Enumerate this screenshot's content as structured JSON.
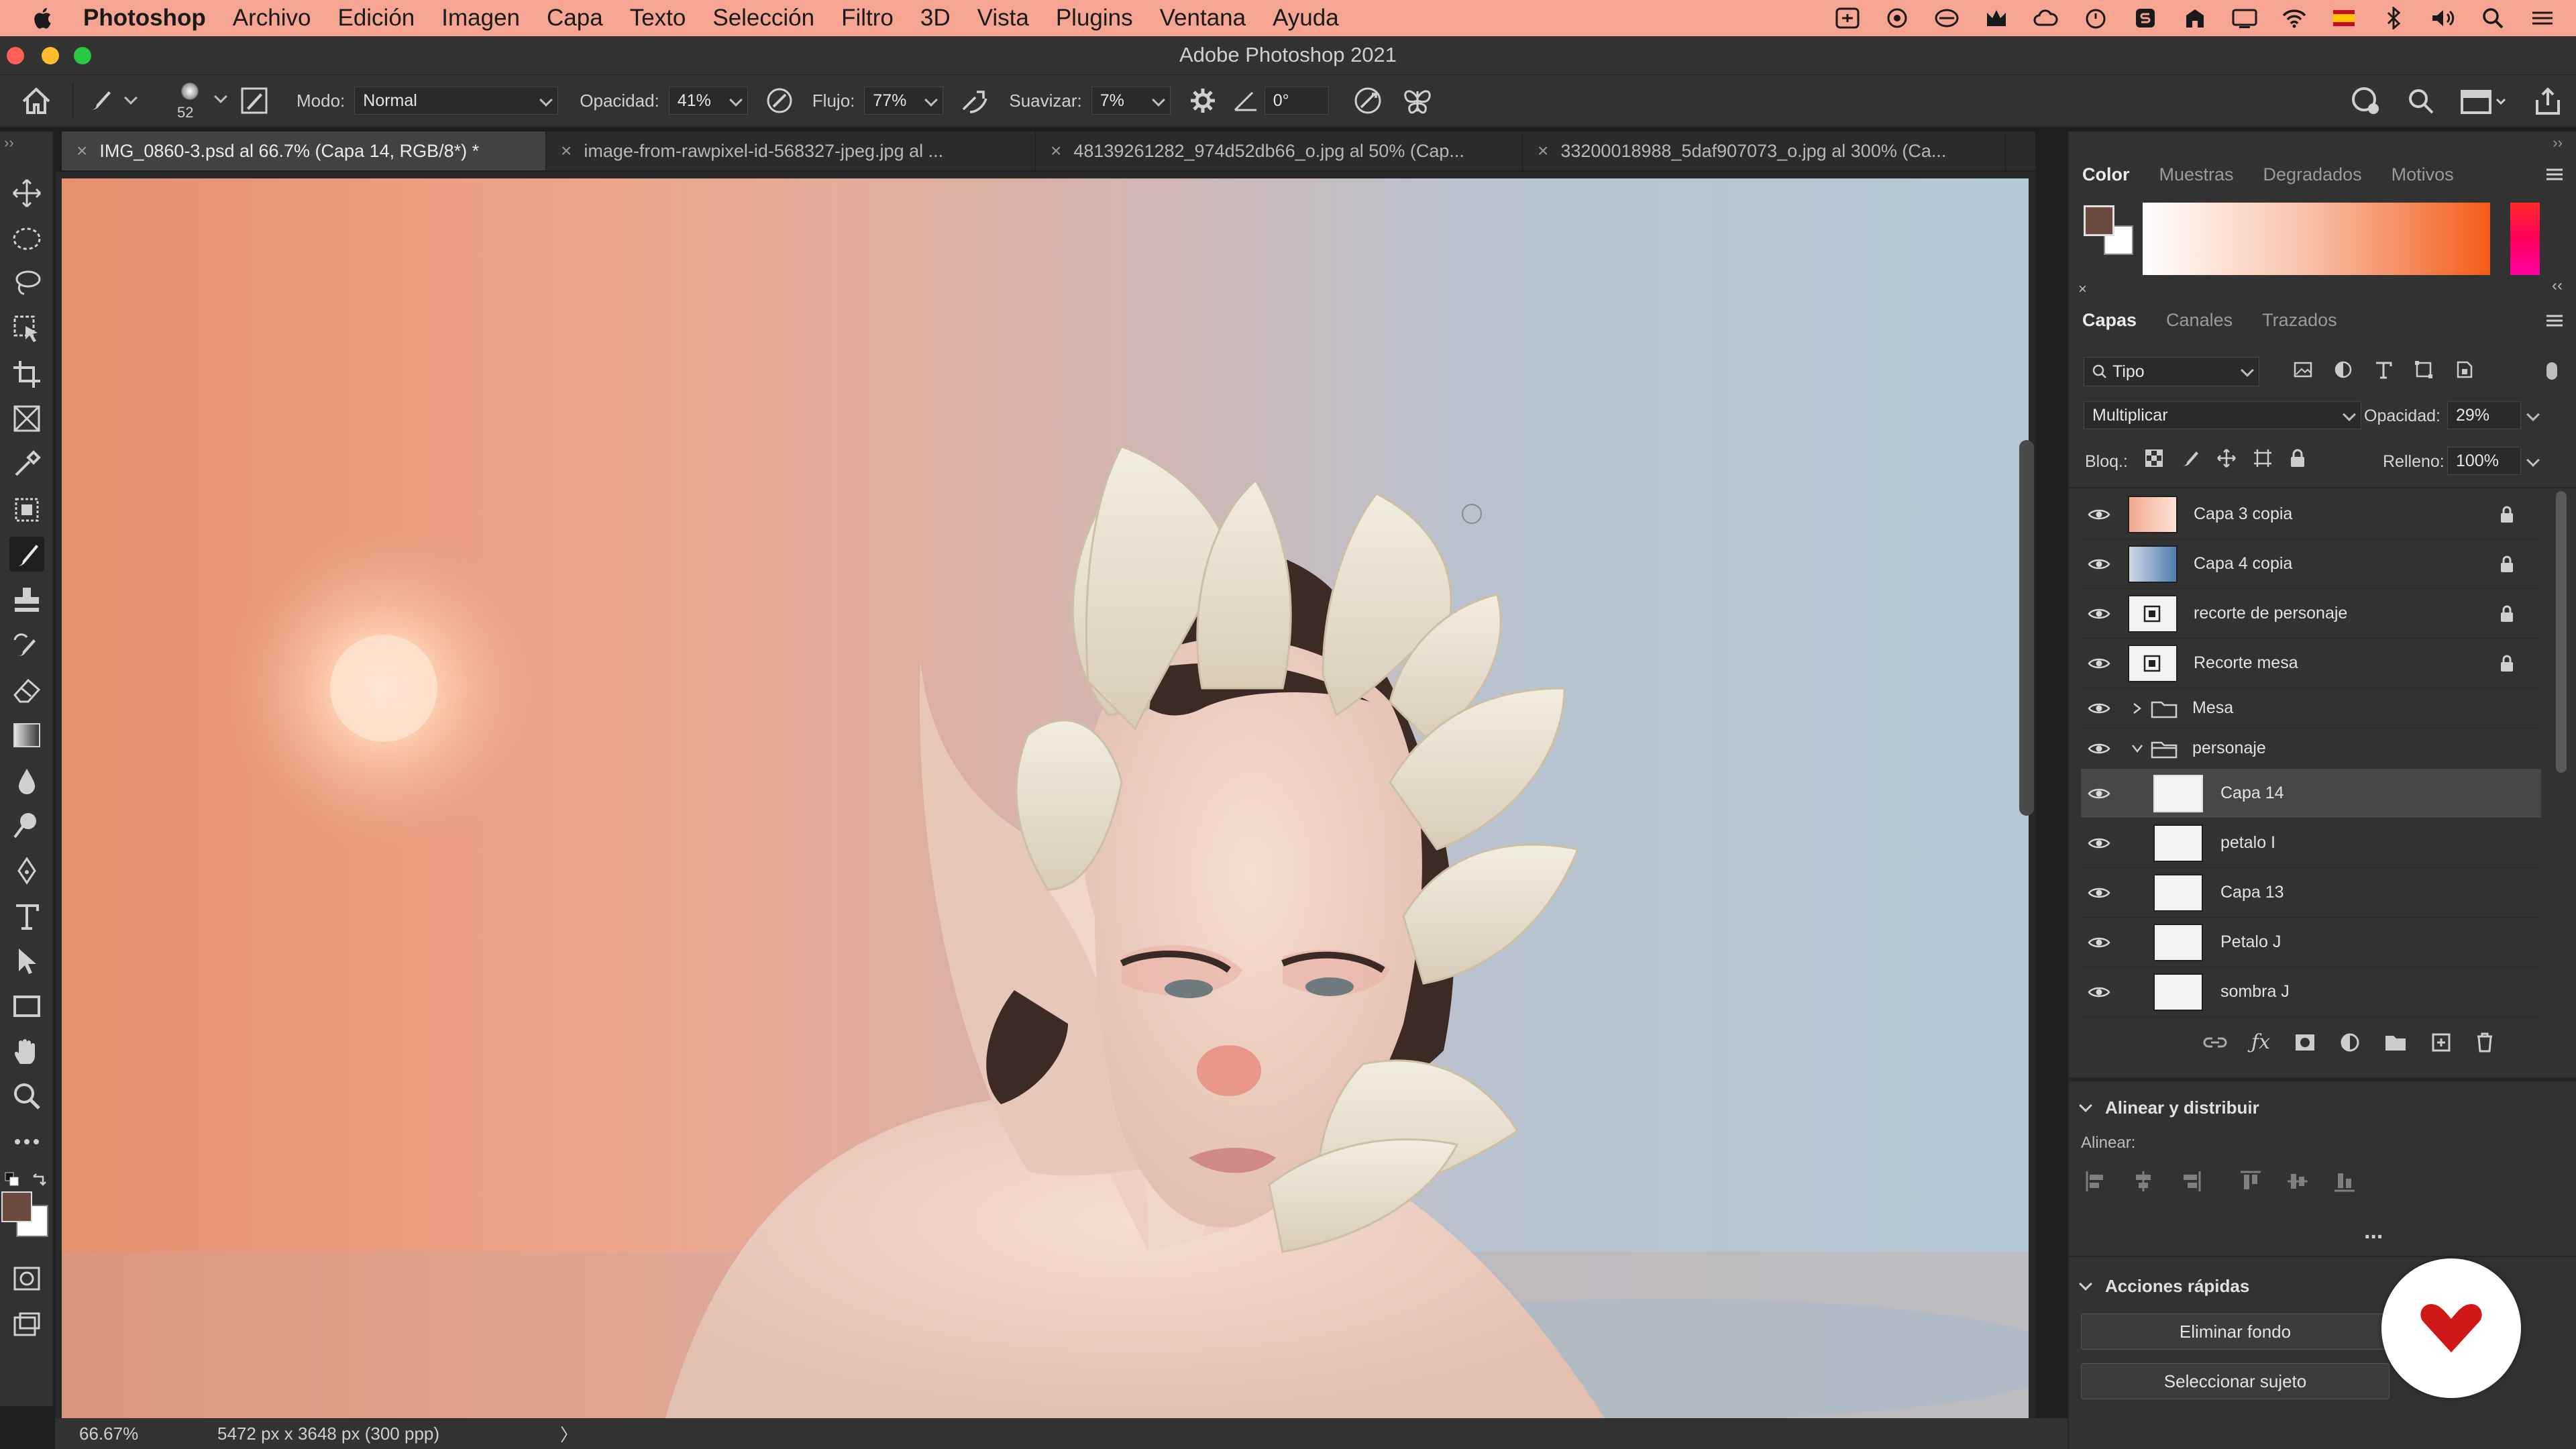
{
  "menubar": {
    "app_name": "Photoshop",
    "items": [
      "Archivo",
      "Edición",
      "Imagen",
      "Capa",
      "Texto",
      "Selección",
      "Filtro",
      "3D",
      "Vista",
      "Plugins",
      "Ventana",
      "Ayuda"
    ]
  },
  "window": {
    "title": "Adobe Photoshop 2021"
  },
  "options": {
    "brush_size": "52",
    "mode_label": "Modo:",
    "mode_value": "Normal",
    "opacity_label": "Opacidad:",
    "opacity_value": "41%",
    "flow_label": "Flujo:",
    "flow_value": "77%",
    "smooth_label": "Suavizar:",
    "smooth_value": "7%",
    "angle_value": "0°"
  },
  "document_tabs": [
    "IMG_0860-3.psd al 66.7% (Capa 14, RGB/8*) *",
    "image-from-rawpixel-id-568327-jpeg.jpg al ...",
    "48139261282_974d52db66_o.jpg al 50% (Cap...",
    "33200018988_5daf907073_o.jpg al 300% (Ca..."
  ],
  "status": {
    "zoom": "66.67%",
    "doc_size": "5472 px x 3648 px (300 ppp)",
    "arrow": "〉"
  },
  "color_panel": {
    "tabs": [
      "Color",
      "Muestras",
      "Degradados",
      "Motivos"
    ],
    "foreground": "#6b4a3f",
    "background": "#ffffff"
  },
  "layers_panel": {
    "tabs": [
      "Capas",
      "Canales",
      "Trazados"
    ],
    "filter_label": "Tipo",
    "blend_mode": "Multiplicar",
    "opacity_label": "Opacidad:",
    "opacity_value": "29%",
    "lock_label": "Bloq.:",
    "fill_label": "Relleno:",
    "fill_value": "100%",
    "layers": [
      {
        "name": "Capa 3 copia",
        "locked": true
      },
      {
        "name": "Capa 4 copia",
        "locked": true
      },
      {
        "name": "recorte de personaje",
        "locked": true
      },
      {
        "name": "Recorte mesa",
        "locked": true
      },
      {
        "name": "Mesa",
        "group": true
      },
      {
        "name": "personaje",
        "group": true
      },
      {
        "name": "Capa 14",
        "selected": true
      },
      {
        "name": "petalo I"
      },
      {
        "name": "Capa 13"
      },
      {
        "name": "Petalo J"
      },
      {
        "name": "sombra J"
      }
    ]
  },
  "align_panel": {
    "title": "Alinear y distribuir",
    "align_label": "Alinear:",
    "more": "..."
  },
  "quick_actions": {
    "title": "Acciones rápidas",
    "buttons": [
      "Eliminar fondo",
      "Seleccionar sujeto"
    ]
  }
}
